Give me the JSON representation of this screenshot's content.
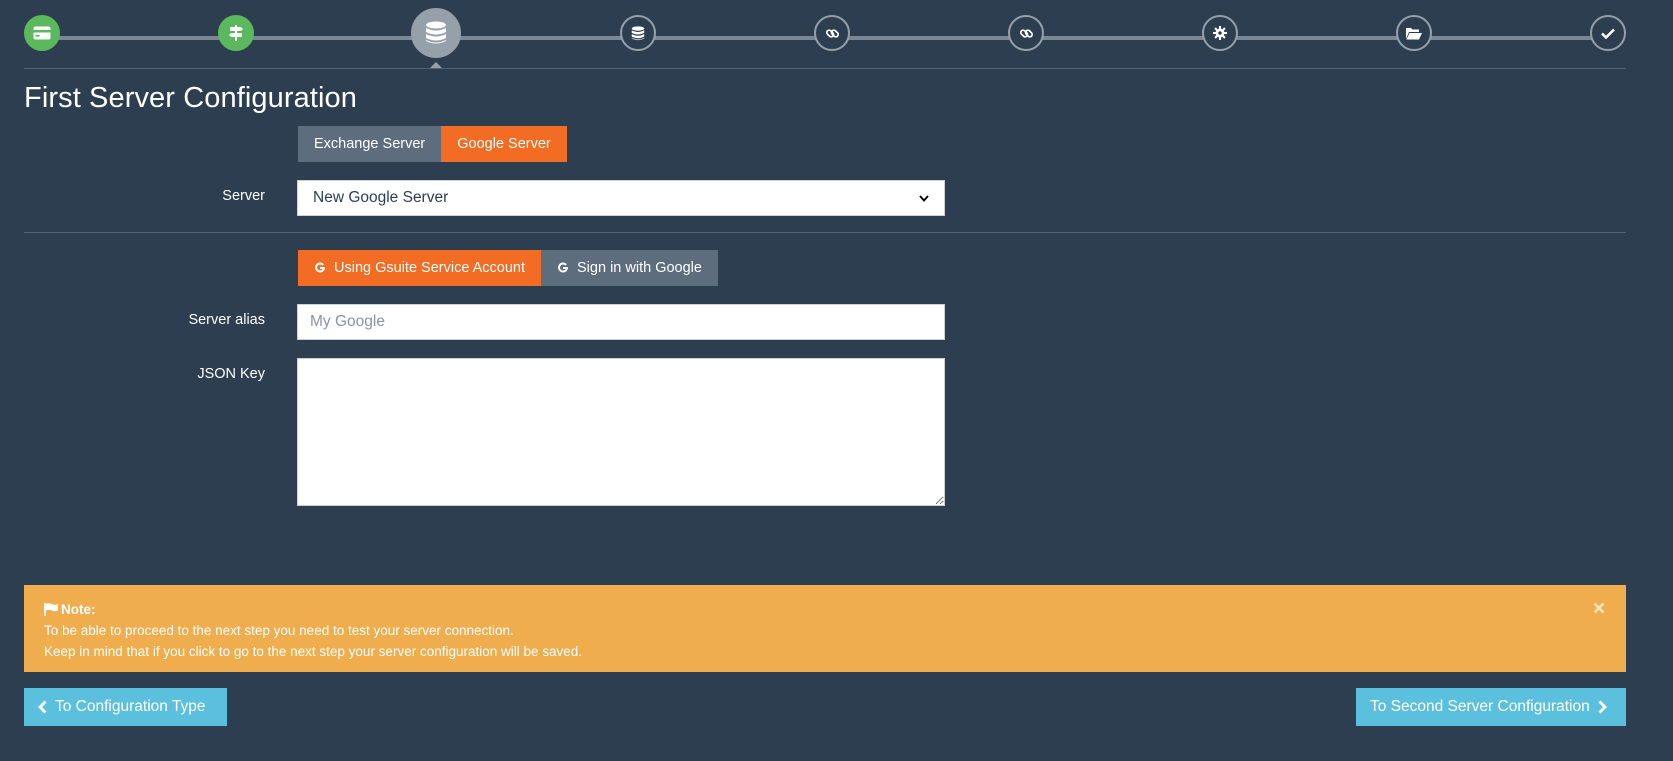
{
  "stepper": {
    "steps": [
      {
        "icon": "credit-card-icon",
        "state": "done"
      },
      {
        "icon": "signpost-icon",
        "state": "done"
      },
      {
        "icon": "database-icon",
        "state": "active"
      },
      {
        "icon": "database-icon",
        "state": "pending"
      },
      {
        "icon": "link-icon",
        "state": "pending"
      },
      {
        "icon": "link-icon",
        "state": "pending"
      },
      {
        "icon": "gear-icon",
        "state": "pending"
      },
      {
        "icon": "folder-open-icon",
        "state": "pending"
      },
      {
        "icon": "checkmark-icon",
        "state": "pending"
      }
    ]
  },
  "page": {
    "title": "First Server Configuration"
  },
  "server_type": {
    "options": [
      "Exchange Server",
      "Google Server"
    ],
    "selected": "Google Server"
  },
  "server_field": {
    "label": "Server",
    "value": "New Google Server"
  },
  "auth_method": {
    "options": [
      {
        "label": "Using Gsuite Service Account",
        "icon": "google-icon",
        "selected": true
      },
      {
        "label": "Sign in with Google",
        "icon": "google-icon",
        "selected": false
      }
    ]
  },
  "server_alias": {
    "label": "Server alias",
    "placeholder": "My Google",
    "value": ""
  },
  "json_key": {
    "label": "JSON Key",
    "value": ""
  },
  "note": {
    "icon": "flag-icon",
    "title": "Note:",
    "lines": [
      "To be able to proceed to the next step you need to test your server connection.",
      "Keep in mind that if you click to go to the next step your server configuration will be saved."
    ]
  },
  "nav": {
    "back_label": "To Configuration Type",
    "next_label": "To Second Server Configuration"
  },
  "colors": {
    "background": "#2c3e50",
    "accent_orange": "#f26c24",
    "muted_button": "#5d6d7e",
    "done_green": "#5cb85c",
    "warning": "#f0ad4e",
    "info": "#5bc0de"
  }
}
